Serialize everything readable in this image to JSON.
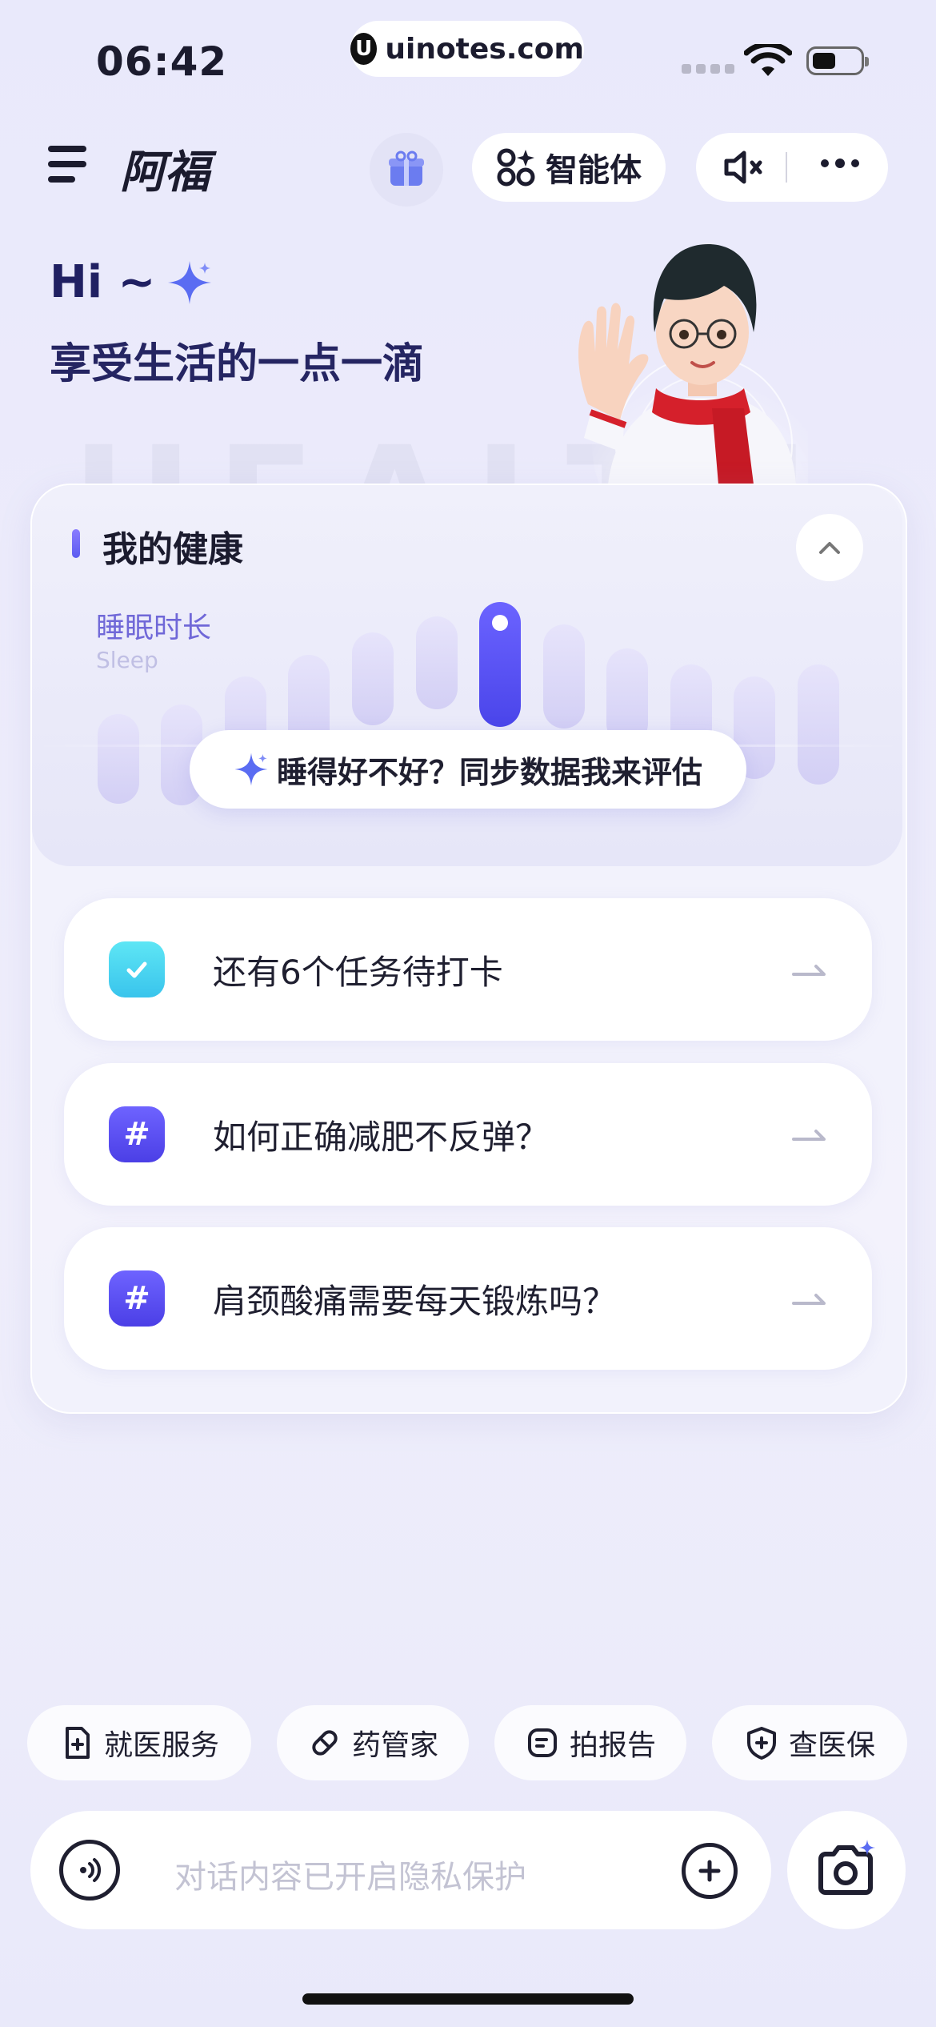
{
  "status_bar": {
    "time": "06:42",
    "url": "uinotes.com"
  },
  "header": {
    "title": "阿福",
    "agent_label": "智能体"
  },
  "greeting": {
    "hi": "Hi ~",
    "tagline": "享受生活的一点一滴"
  },
  "health_card": {
    "title": "我的健康",
    "metric_label": "睡眠时长",
    "metric_sub": "Sleep",
    "sync_prompt": "睡得好不好？同步数据我来评估"
  },
  "tasks": [
    {
      "text": "还有6个任务待打卡",
      "icon": "clipboard-check-icon"
    },
    {
      "text": "如何正确减肥不反弹？",
      "icon": "hashtag-icon"
    },
    {
      "text": "肩颈酸痛需要每天锻炼吗？",
      "icon": "hashtag-icon"
    }
  ],
  "quick_actions": [
    {
      "label": "就医服务",
      "icon": "medical-doc-icon"
    },
    {
      "label": "药管家",
      "icon": "pill-icon"
    },
    {
      "label": "拍报告",
      "icon": "report-icon"
    },
    {
      "label": "查医保",
      "icon": "shield-plus-icon"
    }
  ],
  "input": {
    "placeholder": "对话内容已开启隐私保护"
  },
  "colors": {
    "accent": "#5b54ef",
    "task_icon_cyan": "#4ed8f0",
    "background": "#ececfb"
  }
}
